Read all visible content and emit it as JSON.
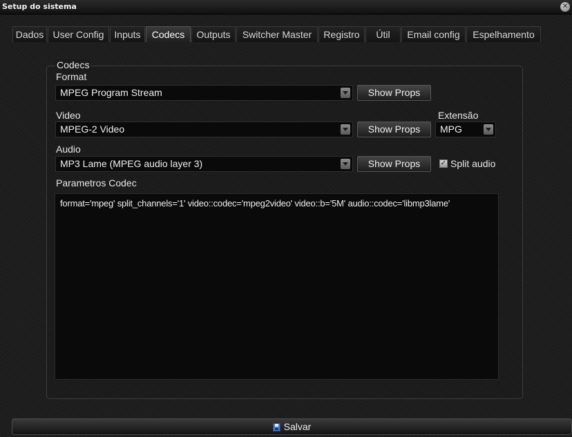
{
  "window": {
    "title": "Setup do sistema",
    "close_icon": "close-icon"
  },
  "tabs": [
    {
      "label": "Dados"
    },
    {
      "label": "User Config"
    },
    {
      "label": "Inputs"
    },
    {
      "label": "Codecs",
      "active": true
    },
    {
      "label": "Outputs"
    },
    {
      "label": "Switcher Master"
    },
    {
      "label": "Registro"
    },
    {
      "label": "Útil"
    },
    {
      "label": "Email config"
    },
    {
      "label": "Espelhamento"
    }
  ],
  "codecs": {
    "legend": "Codecs",
    "format": {
      "label": "Format",
      "value": "MPEG Program Stream",
      "button": "Show Props"
    },
    "video": {
      "label": "Video",
      "value": "MPEG-2 Video",
      "button": "Show Props"
    },
    "extensao": {
      "label": "Extensão",
      "value": "MPG"
    },
    "audio": {
      "label": "Audio",
      "value": "MP3 Lame (MPEG audio layer 3)",
      "button": "Show Props"
    },
    "split_audio": {
      "label": "Split audio",
      "checked": true
    },
    "parametros": {
      "label": "Parametros Codec",
      "value": "format='mpeg' split_channels='1' video::codec='mpeg2video' video::b='5M' audio::codec='libmp3lame'"
    }
  },
  "footer": {
    "save_label": "Salvar",
    "save_icon": "floppy-disk-icon"
  }
}
